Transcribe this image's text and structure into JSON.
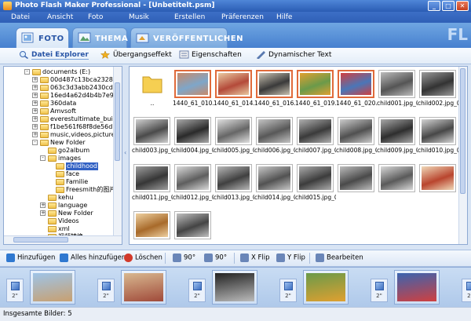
{
  "window": {
    "title": "Photo Flash Maker Professional - [Unbetitelt.psm]",
    "controls": [
      "_",
      "□",
      "✕"
    ]
  },
  "menu": [
    "Datei",
    "Ansicht",
    "Foto",
    "Musik",
    "Erstellen",
    "Präferenzen",
    "Hilfe"
  ],
  "main_tabs": [
    {
      "label": "FOTO",
      "active": true,
      "icon": "photo-icon"
    },
    {
      "label": "THEMA",
      "active": false,
      "icon": "theme-icon"
    },
    {
      "label": "VERÖFFENTLICHEN",
      "active": false,
      "icon": "publish-icon"
    }
  ],
  "brand_mark": "FL",
  "sub_tabs": [
    {
      "label": "Datei Explorer",
      "active": true,
      "icon": "magnifier-icon"
    },
    {
      "label": "Übergangseffekt",
      "active": false,
      "icon": "transition-icon"
    },
    {
      "label": "Eigenschaften",
      "active": false,
      "icon": "properties-icon"
    },
    {
      "label": "Dynamischer Text",
      "active": false,
      "icon": "text-icon"
    }
  ],
  "tree": [
    {
      "label": "documents (E:)",
      "level": 0,
      "expander": "-",
      "icon": "drive-icon"
    },
    {
      "label": "00d487c13bca23280",
      "level": 1,
      "expander": "+"
    },
    {
      "label": "063c3d3abb2430cdfe0cd",
      "level": 1,
      "expander": "+"
    },
    {
      "label": "16ed4a62d4b4b7e93a28e2b",
      "level": 1,
      "expander": "+"
    },
    {
      "label": "360data",
      "level": 1,
      "expander": "+"
    },
    {
      "label": "Amvsoft",
      "level": 1,
      "expander": "+"
    },
    {
      "label": "everestultimate_build_1996",
      "level": 1,
      "expander": "+"
    },
    {
      "label": "f1be561f68f8de56d31c",
      "level": 1,
      "expander": "+"
    },
    {
      "label": "music,videos,pictures",
      "level": 1,
      "expander": "+"
    },
    {
      "label": "New Folder",
      "level": 1,
      "expander": "-"
    },
    {
      "label": "go2album",
      "level": 2,
      "expander": ""
    },
    {
      "label": "images",
      "level": 2,
      "expander": "-"
    },
    {
      "label": "childhood",
      "level": 3,
      "expander": "",
      "selected": true
    },
    {
      "label": "face",
      "level": 3,
      "expander": ""
    },
    {
      "label": "Familie",
      "level": 3,
      "expander": ""
    },
    {
      "label": "Freesmith的图片",
      "level": 3,
      "expander": ""
    },
    {
      "label": "kehu",
      "level": 2,
      "expander": ""
    },
    {
      "label": "language",
      "level": 2,
      "expander": "+"
    },
    {
      "label": "New Folder",
      "level": 2,
      "expander": "+"
    },
    {
      "label": "Videos",
      "level": 2,
      "expander": ""
    },
    {
      "label": "xml",
      "level": 2,
      "expander": ""
    },
    {
      "label": "视频转换",
      "level": 2,
      "expander": ""
    }
  ],
  "thumbnails": [
    {
      "caption": "..",
      "kind": "folder",
      "highlighted": false
    },
    {
      "caption": "1440_61_010.jpg",
      "highlighted": true,
      "colors": [
        "#7ea6c9",
        "#c88a6a"
      ]
    },
    {
      "caption": "1440_61_014.jpg",
      "highlighted": true,
      "colors": [
        "#b44a3a",
        "#e9c9a0"
      ]
    },
    {
      "caption": "1440_61_016.jpg",
      "highlighted": true,
      "colors": [
        "#3a3a3a",
        "#c8c0b0"
      ]
    },
    {
      "caption": "1440_61_019.jpg",
      "highlighted": true,
      "colors": [
        "#6a9a4a",
        "#e0a030"
      ]
    },
    {
      "caption": "1440_61_020.jpg",
      "highlighted": true,
      "colors": [
        "#4a76b8",
        "#d04040"
      ]
    },
    {
      "caption": "child001.jpg_0...",
      "highlighted": false,
      "colors": [
        "#555555",
        "#bbbbbb"
      ]
    },
    {
      "caption": "child002.jpg_01...",
      "highlighted": false,
      "colors": [
        "#333333",
        "#999999"
      ]
    },
    {
      "caption": "child003.jpg_01...",
      "highlighted": false,
      "colors": [
        "#4a4a4a",
        "#d0d0d0"
      ]
    },
    {
      "caption": "child004.jpg_01...",
      "highlighted": false,
      "colors": [
        "#2a2a2a",
        "#aaaaaa"
      ]
    },
    {
      "caption": "child005.jpg_01...",
      "highlighted": false,
      "colors": [
        "#666666",
        "#e0e0e0"
      ]
    },
    {
      "caption": "child006.jpg_01...",
      "highlighted": false,
      "colors": [
        "#585858",
        "#c4c4c4"
      ]
    },
    {
      "caption": "child007.jpg_01...",
      "highlighted": false,
      "colors": [
        "#3a3a3a",
        "#b0b0b0"
      ]
    },
    {
      "caption": "child008.jpg_01...",
      "highlighted": false,
      "colors": [
        "#505050",
        "#cccccc"
      ]
    },
    {
      "caption": "child009.jpg_01...",
      "highlighted": false,
      "colors": [
        "#2e2e2e",
        "#a8a8a8"
      ]
    },
    {
      "caption": "child010.jpg_01...",
      "highlighted": false,
      "colors": [
        "#474747",
        "#d4d4d4"
      ]
    },
    {
      "caption": "child011.jpg_01...",
      "highlighted": false,
      "colors": [
        "#363636",
        "#9e9e9e"
      ]
    },
    {
      "caption": "child012.jpg_01...",
      "highlighted": false,
      "colors": [
        "#5e5e5e",
        "#dadada"
      ]
    },
    {
      "caption": "child013.jpg_01...",
      "highlighted": false,
      "colors": [
        "#404040",
        "#b8b8b8"
      ]
    },
    {
      "caption": "child014.jpg_01...",
      "highlighted": false,
      "colors": [
        "#525252",
        "#c8c8c8"
      ]
    },
    {
      "caption": "child015.jpg_01...",
      "highlighted": false,
      "colors": [
        "#3c3c3c",
        "#acacac"
      ]
    },
    {
      "caption": "",
      "highlighted": false,
      "colors": [
        "#4a4a4a",
        "#bcbcbc"
      ]
    },
    {
      "caption": "",
      "highlighted": false,
      "colors": [
        "#5a5a5a",
        "#d8d8d8"
      ]
    },
    {
      "caption": "",
      "highlighted": false,
      "colors": [
        "#b9452e",
        "#f0d8b8"
      ]
    },
    {
      "caption": "",
      "highlighted": false,
      "colors": [
        "#a86a2a",
        "#eed0a0"
      ]
    },
    {
      "caption": "",
      "highlighted": false,
      "colors": [
        "#444444",
        "#c0c0c0"
      ]
    }
  ],
  "toolbar": [
    {
      "label": "Hinzufügen",
      "icon": "add-icon",
      "color": "#2f78d0"
    },
    {
      "label": "Alles hinzufügen",
      "icon": "add-all-icon",
      "color": "#2f78d0"
    },
    {
      "label": "Löschen",
      "icon": "delete-icon",
      "color": "#d23a2a"
    },
    {
      "label": "90°",
      "icon": "rotate-left-icon",
      "color": "#6a86b8"
    },
    {
      "label": "90°",
      "icon": "rotate-right-icon",
      "color": "#6a86b8"
    },
    {
      "label": "X Flip",
      "icon": "flip-x-icon",
      "color": "#6a86b8"
    },
    {
      "label": "Y Flip",
      "icon": "flip-y-icon",
      "color": "#6a86b8"
    },
    {
      "label": "Bearbeiten",
      "icon": "edit-icon",
      "color": "#6a86b8"
    }
  ],
  "storyboard": {
    "transition_duration": "2\"",
    "slides": [
      {
        "colors": [
          "#9ec4e8",
          "#c8a070"
        ]
      },
      {
        "colors": [
          "#d8b890",
          "#a04a3a"
        ]
      },
      {
        "colors": [
          "#222222",
          "#bbbbbb"
        ]
      },
      {
        "colors": [
          "#6a9a4a",
          "#e0a030"
        ]
      },
      {
        "colors": [
          "#3a64b0",
          "#d04040"
        ]
      }
    ]
  },
  "status": {
    "text": "Insgesamte Bilder: 5"
  },
  "colors": {
    "accent": "#2a56a6",
    "highlight": "#e06a3a",
    "selection": "#3161c4"
  }
}
